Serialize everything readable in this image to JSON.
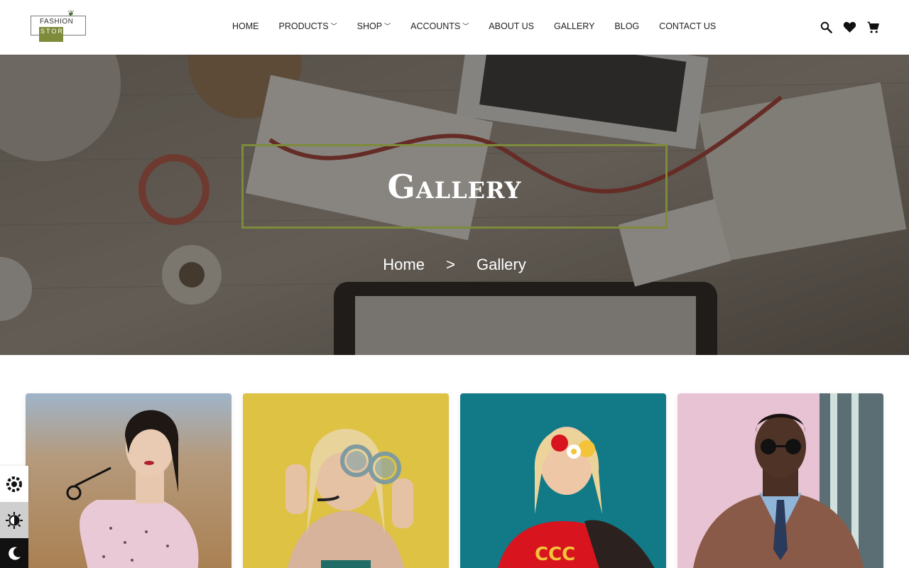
{
  "logo": {
    "line1": "FASHION",
    "line2": "STORE"
  },
  "nav": {
    "items": [
      {
        "label": "HOME",
        "has_dropdown": false
      },
      {
        "label": "PRODUCTS",
        "has_dropdown": true
      },
      {
        "label": "SHOP",
        "has_dropdown": true
      },
      {
        "label": "ACCOUNTS",
        "has_dropdown": true
      },
      {
        "label": "ABOUT US",
        "has_dropdown": false
      },
      {
        "label": "GALLERY",
        "has_dropdown": false
      },
      {
        "label": "BLOG",
        "has_dropdown": false
      },
      {
        "label": "CONTACT US",
        "has_dropdown": false
      }
    ],
    "icons": [
      "search-icon",
      "heart-icon",
      "cart-icon"
    ]
  },
  "hero": {
    "title": "Gallery",
    "breadcrumb": {
      "home": "Home",
      "separator": ">",
      "current": "Gallery"
    }
  },
  "gallery": {
    "images": [
      "model-field-pink-dress",
      "model-yellow-wall-round-glasses",
      "model-teal-red-shirt-flower",
      "model-brown-leather-jacket"
    ]
  },
  "theme_tools": [
    "settings-icon",
    "contrast-icon",
    "moon-icon"
  ],
  "colors": {
    "accent": "#7d8b3a",
    "text": "#222222",
    "hero_overlay": "#1a1612"
  }
}
